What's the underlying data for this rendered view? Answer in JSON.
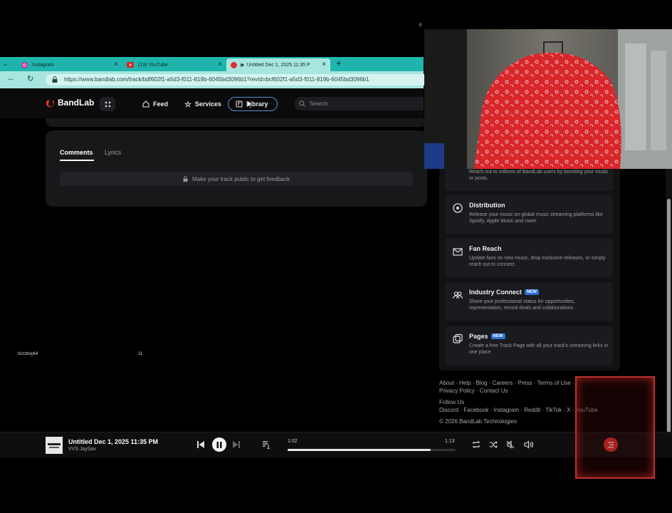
{
  "browser": {
    "tabs": [
      {
        "label": "Instagram",
        "icon": "instagram-icon"
      },
      {
        "label": "(19) YouTube",
        "icon": "youtube-icon"
      },
      {
        "label": "Untitled Dec 1, 2025 11:35 P",
        "icon": "bandlab-icon"
      }
    ],
    "url": "https://www.bandlab.com/track/bdf602f1-a5d3-f011-819b-6045bd3096b1?revId=bcf602f1-a5d3-f011-819b-6045bd3096b1"
  },
  "nav": {
    "brand": "BandLab",
    "items": [
      "Feed",
      "Services",
      "Library"
    ],
    "active": "Library",
    "search_placeholder": "Search"
  },
  "comments": {
    "tabs": [
      "Comments",
      "Lyrics"
    ],
    "active_tab": "Comments",
    "notice": "Make your track public to get feedback"
  },
  "services": {
    "partial_desc": "Reach out to millions of BandLab users by boosting your music or posts.",
    "items": [
      {
        "title": "Distribution",
        "badge": "",
        "desc": "Release your music on global music streaming platforms like Spotify, Apple Music and more.",
        "icon": "distribution-icon"
      },
      {
        "title": "Fan Reach",
        "badge": "",
        "desc": "Update fans on new music, drop exclusive releases, or simply reach out to connect.",
        "icon": "mail-icon"
      },
      {
        "title": "Industry Connect",
        "badge": "NEW",
        "desc": "Share your professional status for opportunities, representation, record deals and collaborations.",
        "icon": "people-icon"
      },
      {
        "title": "Pages",
        "badge": "NEW",
        "desc": "Create a free Track Page with all your track's streaming links in one place",
        "icon": "pages-icon"
      }
    ]
  },
  "footer": {
    "links1": "About · Help · Blog · Careers · Press · Terms of Use ·",
    "links2": "Privacy Policy · Contact Us",
    "follow": "Follow Us",
    "social": "Discord · Facebook · Instagram · Reddit · TikTok · X · YouTube",
    "copyright": "© 2026 BandLab Technologies"
  },
  "stream_overlay": {
    "username": "tizzzboy64",
    "count": "11",
    "cam_counter": "0"
  },
  "player": {
    "title": "Untitled Dec 1, 2025 11:35 PM",
    "artist": "VVS.JaySav",
    "elapsed": "1:02",
    "total": "1:13",
    "progress": 0.85
  }
}
